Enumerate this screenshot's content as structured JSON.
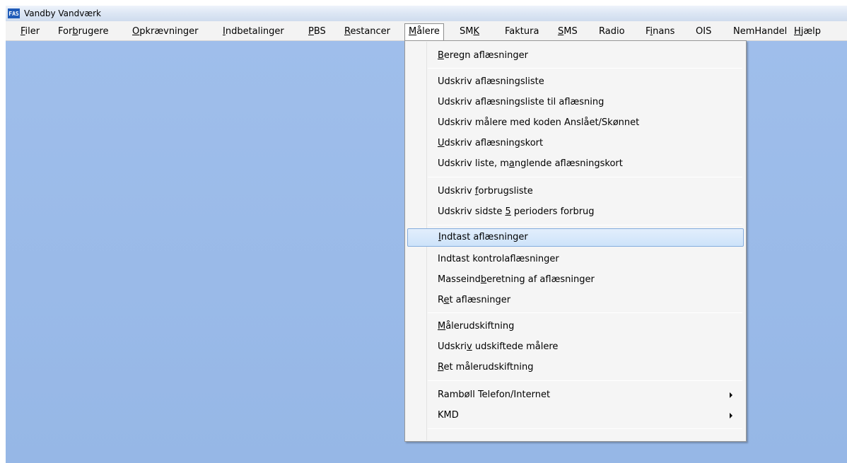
{
  "app": {
    "icon_text": "FAS",
    "title": "Vandby Vandværk"
  },
  "menubar": {
    "items": [
      {
        "pre": "",
        "mn": "F",
        "post": "iler"
      },
      {
        "pre": "For",
        "mn": "b",
        "post": "rugere"
      },
      {
        "pre": "",
        "mn": "O",
        "post": "pkrævninger"
      },
      {
        "pre": "",
        "mn": "I",
        "post": "ndbetalinger"
      },
      {
        "pre": "",
        "mn": "P",
        "post": "BS"
      },
      {
        "pre": "",
        "mn": "R",
        "post": "estancer"
      },
      {
        "pre": "",
        "mn": "M",
        "post": "ålere"
      },
      {
        "pre": "SM",
        "mn": "K",
        "post": ""
      },
      {
        "pre": "Faktura",
        "mn": "",
        "post": ""
      },
      {
        "pre": "",
        "mn": "S",
        "post": "MS"
      },
      {
        "pre": "Radio",
        "mn": "",
        "post": ""
      },
      {
        "pre": "F",
        "mn": "i",
        "post": "nans"
      },
      {
        "pre": "OIS",
        "mn": "",
        "post": ""
      },
      {
        "pre": "NemHandel",
        "mn": "",
        "post": ""
      },
      {
        "pre": "",
        "mn": "H",
        "post": "jælp"
      }
    ]
  },
  "dropdown": {
    "items": [
      {
        "pre": "",
        "mn": "B",
        "post": "eregn aflæsninger"
      },
      {
        "pre": "Udskriv af",
        "mn": "l",
        "post": "æsningsliste"
      },
      {
        "pre": "Udskriv af",
        "mn": "l",
        "post": "æsningsliste til aflæsning"
      },
      {
        "pre": "Udskriv målere med koden Anslået/Skønnet",
        "mn": "",
        "post": ""
      },
      {
        "pre": "",
        "mn": "U",
        "post": "dskriv aflæsningskort"
      },
      {
        "pre": "Udskriv liste, m",
        "mn": "a",
        "post": "nglende aflæsningskort"
      },
      {
        "pre": "Udskriv ",
        "mn": "f",
        "post": "orbrugsliste"
      },
      {
        "pre": "Udskriv sidste ",
        "mn": "5",
        "post": " perioders forbrug"
      },
      {
        "pre": "",
        "mn": "I",
        "post": "ndtast aflæsninger"
      },
      {
        "pre": "Indtast kontrolaflæsninger",
        "mn": "",
        "post": ""
      },
      {
        "pre": "Masseind",
        "mn": "b",
        "post": "eretning af aflæsninger"
      },
      {
        "pre": "R",
        "mn": "e",
        "post": "t aflæsninger"
      },
      {
        "pre": "",
        "mn": "M",
        "post": "ålerudskiftning"
      },
      {
        "pre": "Udskri",
        "mn": "v",
        "post": " udskiftede målere"
      },
      {
        "pre": "",
        "mn": "R",
        "post": "et målerudskiftning"
      },
      {
        "pre": "Rambøll Telefon/Internet",
        "mn": "",
        "post": ""
      },
      {
        "pre": "KMD",
        "mn": "",
        "post": ""
      }
    ]
  }
}
